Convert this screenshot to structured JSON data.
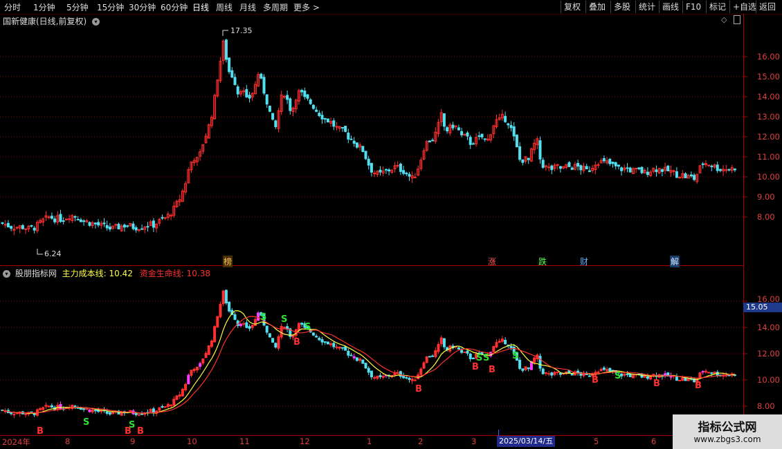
{
  "toolbar": {
    "periods": [
      "分时",
      "1分钟",
      "5分钟",
      "15分钟",
      "30分钟",
      "60分钟",
      "日线",
      "周线",
      "月线",
      "多周期",
      "更多 >"
    ],
    "active_period": "日线",
    "buttons": [
      "复权",
      "叠加",
      "多股",
      "统计",
      "画线",
      "F10",
      "标记",
      "+自选",
      "返回"
    ]
  },
  "main": {
    "title": "国新健康(日线,前复权)",
    "expand_icon": "chevron-down-icon",
    "high_label": "17.35",
    "low_label": "6.24",
    "y_ticks": [
      "16.00",
      "15.00",
      "14.00",
      "13.00",
      "12.00",
      "11.00",
      "10.00",
      "9.00",
      "8.00"
    ],
    "events": [
      {
        "label": "榜",
        "color": "#d8a040"
      },
      {
        "label": "涨",
        "color": "#ff4040"
      },
      {
        "label": "跌",
        "color": "#40ff40"
      },
      {
        "label": "财",
        "color": "#40a0ff"
      },
      {
        "label": "解",
        "color": "#80c0ff"
      }
    ]
  },
  "indicator": {
    "name": "股朋指标网",
    "line1_label": "主力成本线:",
    "line1_value": "10.42",
    "line2_label": "资金生命线:",
    "line2_value": "10.38",
    "y_ticks": [
      "16.00",
      "14.00",
      "12.00",
      "10.00",
      "8.00"
    ],
    "cursor_value": "15.05",
    "buy_label": "B",
    "sell_label": "S"
  },
  "x_axis": {
    "labels": [
      "2024年",
      "8",
      "9",
      "10",
      "11",
      "12",
      "1",
      "2",
      "3",
      "5",
      "6"
    ],
    "cursor_date": "2025/03/14/五"
  },
  "watermark": {
    "line1": "指标公式网",
    "line2": "www.zbgs3.com"
  },
  "colors": {
    "up": "#ff3030",
    "down": "#50e0f0",
    "cost_line": "#ffff40",
    "life_line": "#ff3030",
    "magenta": "#ff40ff",
    "grid": "#8a0000"
  },
  "chart_data": {
    "type": "candlestick",
    "title": "国新健康(日线,前复权)",
    "y_range": [
      7.4,
      17.6
    ],
    "series": [
      {
        "name": "close_trend",
        "points": [
          [
            0,
            7.7
          ],
          [
            8,
            7.6
          ],
          [
            16,
            7.5
          ],
          [
            24,
            7.5
          ],
          [
            32,
            7.5
          ],
          [
            40,
            7.4
          ],
          [
            50,
            7.5
          ],
          [
            60,
            7.8
          ],
          [
            70,
            8.0
          ],
          [
            80,
            7.9
          ],
          [
            90,
            7.9
          ],
          [
            100,
            8.1
          ],
          [
            110,
            8.0
          ],
          [
            120,
            7.8
          ],
          [
            130,
            7.7
          ],
          [
            140,
            7.6
          ],
          [
            150,
            7.5
          ],
          [
            160,
            7.4
          ],
          [
            170,
            7.5
          ],
          [
            180,
            7.6
          ],
          [
            190,
            7.5
          ],
          [
            200,
            7.5
          ],
          [
            210,
            7.6
          ],
          [
            220,
            7.6
          ],
          [
            230,
            7.8
          ],
          [
            240,
            8.0
          ],
          [
            250,
            8.4
          ],
          [
            258,
            8.9
          ],
          [
            265,
            9.5
          ],
          [
            272,
            10.5
          ],
          [
            278,
            11.0
          ],
          [
            285,
            10.8
          ],
          [
            292,
            11.7
          ],
          [
            300,
            12.5
          ],
          [
            307,
            13.5
          ],
          [
            312,
            14.8
          ],
          [
            318,
            16.0
          ],
          [
            322,
            16.8
          ],
          [
            326,
            15.8
          ],
          [
            330,
            15.2
          ],
          [
            336,
            15.0
          ],
          [
            342,
            14.2
          ],
          [
            348,
            14.5
          ],
          [
            354,
            13.8
          ],
          [
            360,
            14.0
          ],
          [
            366,
            14.4
          ],
          [
            372,
            15.2
          ],
          [
            378,
            14.5
          ],
          [
            384,
            13.8
          ],
          [
            390,
            13.0
          ],
          [
            396,
            12.3
          ],
          [
            402,
            13.5
          ],
          [
            408,
            14.3
          ],
          [
            414,
            13.8
          ],
          [
            420,
            13.2
          ],
          [
            426,
            14.0
          ],
          [
            432,
            14.3
          ],
          [
            438,
            13.9
          ],
          [
            444,
            13.8
          ],
          [
            450,
            13.6
          ],
          [
            456,
            13.3
          ],
          [
            462,
            13.1
          ],
          [
            468,
            12.9
          ],
          [
            474,
            12.8
          ],
          [
            480,
            12.6
          ],
          [
            486,
            12.4
          ],
          [
            492,
            12.3
          ],
          [
            498,
            12.2
          ],
          [
            504,
            11.9
          ],
          [
            510,
            11.8
          ],
          [
            516,
            11.5
          ],
          [
            522,
            11.4
          ],
          [
            528,
            10.9
          ],
          [
            534,
            10.4
          ],
          [
            540,
            10.2
          ],
          [
            546,
            10.1
          ],
          [
            552,
            10.2
          ],
          [
            558,
            10.3
          ],
          [
            564,
            10.4
          ],
          [
            570,
            10.5
          ],
          [
            576,
            10.4
          ],
          [
            582,
            10.3
          ],
          [
            588,
            10.1
          ],
          [
            594,
            9.9
          ],
          [
            600,
            10.2
          ],
          [
            606,
            10.8
          ],
          [
            612,
            11.6
          ],
          [
            618,
            11.8
          ],
          [
            624,
            11.9
          ],
          [
            630,
            12.3
          ],
          [
            636,
            13.1
          ],
          [
            642,
            12.3
          ],
          [
            648,
            12.4
          ],
          [
            654,
            12.6
          ],
          [
            660,
            12.4
          ],
          [
            666,
            12.0
          ],
          [
            672,
            12.0
          ],
          [
            678,
            11.7
          ],
          [
            684,
            11.8
          ],
          [
            690,
            11.9
          ],
          [
            696,
            12.0
          ],
          [
            702,
            11.7
          ],
          [
            708,
            12.3
          ],
          [
            714,
            12.8
          ],
          [
            720,
            12.8
          ],
          [
            726,
            13.0
          ],
          [
            732,
            12.8
          ],
          [
            738,
            12.3
          ],
          [
            744,
            11.6
          ],
          [
            750,
            10.8
          ],
          [
            756,
            10.9
          ],
          [
            762,
            10.8
          ],
          [
            768,
            11.4
          ],
          [
            774,
            11.9
          ],
          [
            780,
            10.7
          ],
          [
            786,
            10.5
          ],
          [
            792,
            10.4
          ],
          [
            798,
            10.4
          ],
          [
            804,
            10.5
          ],
          [
            810,
            10.4
          ],
          [
            816,
            10.5
          ],
          [
            822,
            10.5
          ],
          [
            828,
            10.5
          ],
          [
            834,
            10.5
          ],
          [
            840,
            10.4
          ],
          [
            846,
            10.3
          ],
          [
            852,
            10.4
          ],
          [
            858,
            10.7
          ],
          [
            864,
            10.8
          ],
          [
            870,
            10.7
          ],
          [
            876,
            10.7
          ],
          [
            882,
            10.6
          ],
          [
            888,
            10.5
          ],
          [
            894,
            10.4
          ],
          [
            900,
            10.4
          ],
          [
            906,
            10.4
          ],
          [
            912,
            10.3
          ],
          [
            918,
            10.3
          ],
          [
            924,
            10.3
          ],
          [
            930,
            10.2
          ],
          [
            936,
            10.3
          ],
          [
            942,
            10.4
          ],
          [
            948,
            10.4
          ],
          [
            954,
            10.4
          ],
          [
            960,
            10.3
          ],
          [
            966,
            10.3
          ],
          [
            972,
            10.2
          ],
          [
            978,
            10.1
          ],
          [
            984,
            10.1
          ],
          [
            990,
            10.0
          ],
          [
            996,
            10.0
          ],
          [
            1002,
            9.9
          ],
          [
            1008,
            10.3
          ],
          [
            1014,
            10.7
          ],
          [
            1020,
            10.7
          ],
          [
            1026,
            10.6
          ],
          [
            1032,
            10.5
          ],
          [
            1038,
            10.4
          ],
          [
            1044,
            10.4
          ],
          [
            1050,
            10.4
          ],
          [
            1056,
            10.4
          ],
          [
            1062,
            10.5
          ]
        ]
      }
    ]
  }
}
